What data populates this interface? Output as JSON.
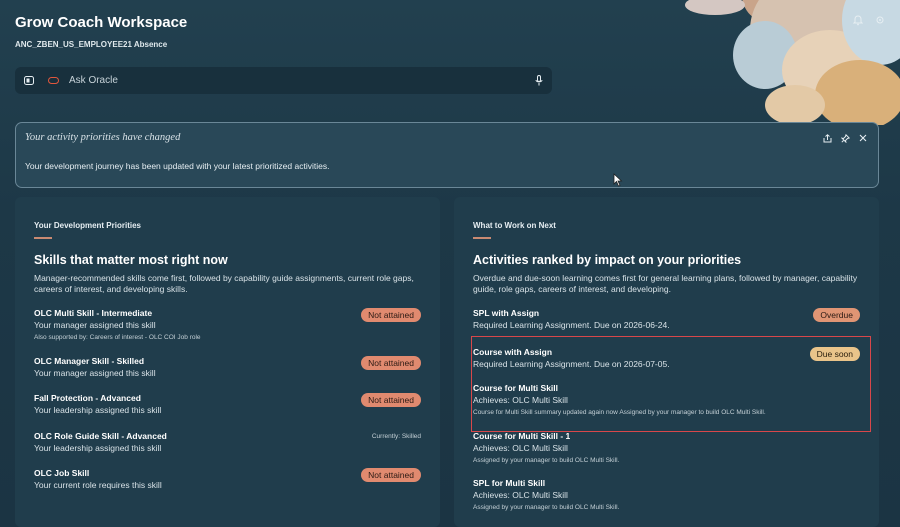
{
  "app": {
    "title": "Grow Coach Workspace",
    "subtitle": "ANC_ZBEN_US_EMPLOYEE21 Absence"
  },
  "icons": {
    "bell": "bell-icon",
    "settings": "settings-icon",
    "sidebar_toggle": "panel-icon",
    "oracle": "oracle-logo-icon",
    "mic": "microphone-icon",
    "share": "share-icon",
    "pin": "pin-icon",
    "close": "close-icon"
  },
  "search": {
    "placeholder": "Ask Oracle"
  },
  "notice": {
    "title": "Your activity priorities have changed",
    "body": "Your development journey has been updated with your latest prioritized activities."
  },
  "left_card": {
    "eyebrow": "Your Development Priorities",
    "title": "Skills that matter most right now",
    "desc": "Manager-recommended skills come first, followed by capability guide assignments, current role gaps, careers of interest, and developing skills.",
    "items": [
      {
        "name": "OLC Multi Skill - Intermediate",
        "sub": "Your manager assigned this skill",
        "note": "Also supported by: Careers of interest - OLC COI Job role",
        "badge": "Not attained"
      },
      {
        "name": "OLC Manager Skill - Skilled",
        "sub": "Your manager assigned this skill",
        "badge": "Not attained"
      },
      {
        "name": "Fall Protection - Advanced",
        "sub": "Your leadership assigned this skill",
        "badge": "Not attained"
      },
      {
        "name": "OLC Role Guide Skill - Advanced",
        "sub": "Your leadership assigned this skill",
        "status": "Currently: Skilled"
      },
      {
        "name": "OLC Job Skill",
        "sub": "Your current role requires this skill",
        "badge": "Not attained"
      }
    ]
  },
  "right_card": {
    "eyebrow": "What to Work on Next",
    "title": "Activities ranked by impact on your priorities",
    "desc": "Overdue and due-soon learning comes first for general learning plans, followed by manager, capability guide, role gaps, careers of interest, and developing.",
    "items": [
      {
        "name": "SPL with Assign",
        "sub": "Required Learning Assignment. Due on 2026-06-24.",
        "badge": "Overdue"
      },
      {
        "name": "Course with Assign",
        "sub": "Required Learning Assignment. Due on 2026-07-05.",
        "badge": "Due soon"
      },
      {
        "name": "Course for Multi Skill",
        "sub": "Achieves: OLC Multi Skill",
        "note": "Course for Multi Skill summary updated again now Assigned by your manager to build OLC Multi Skill."
      },
      {
        "name": "Course for Multi Skill - 1",
        "sub": "Achieves: OLC Multi Skill",
        "note": "Assigned by your manager to build OLC Multi Skill."
      },
      {
        "name": "SPL for Multi Skill",
        "sub": "Achieves: OLC Multi Skill",
        "note": "Assigned by your manager to build OLC Multi Skill."
      }
    ]
  },
  "colors": {
    "background": "#1f3a4a",
    "card": "#203d4c",
    "badge_not_attained": "#e08a6f",
    "badge_overdue": "#e09574",
    "badge_due_soon": "#e9c48a",
    "highlight_border": "#d8474a"
  }
}
